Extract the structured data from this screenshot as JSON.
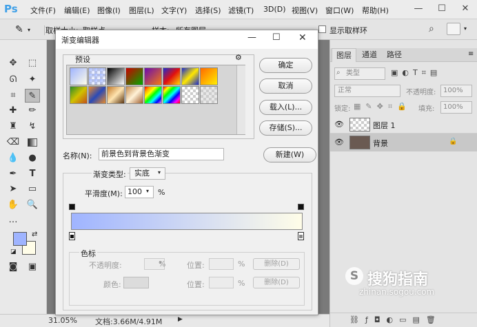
{
  "app": {
    "logo": "Ps"
  },
  "menu": [
    "文件(F)",
    "编辑(E)",
    "图像(I)",
    "图层(L)",
    "文字(Y)",
    "选择(S)",
    "滤镜(T)",
    "3D(D)",
    "视图(V)",
    "窗口(W)",
    "帮助(H)"
  ],
  "window_controls": {
    "minimize": "—",
    "maximize": "☐",
    "close": "✕"
  },
  "options_bar": {
    "sample_size_label": "取样大小:",
    "sample_size_value": "取样点",
    "sample_label": "样本:",
    "sample_value": "所有图层",
    "show_ring_label": "显示取样环"
  },
  "dialog": {
    "title": "渐变编辑器",
    "presets_label": "预设",
    "gear": "⚙",
    "buttons": {
      "ok": "确定",
      "cancel": "取消",
      "load": "载入(L)...",
      "save": "存储(S)...",
      "new": "新建(W)"
    },
    "name_label": "名称(N):",
    "name_value": "前景色到背景色渐变",
    "gradient_type_label": "渐变类型:",
    "gradient_type_value": "实底",
    "smoothness_label": "平滑度(M):",
    "smoothness_value": "100",
    "smoothness_unit": "%",
    "stops_section": "色标",
    "opacity_label": "不透明度:",
    "opacity_unit": "%",
    "position_label_1": "位置:",
    "position_unit_1": "%",
    "delete_label_1": "删除(D)",
    "color_label": "颜色:",
    "position_label_2": "位置:",
    "position_unit_2": "%",
    "delete_label_2": "删除(D)",
    "gradient_colors": {
      "start": "#9fb4ff",
      "end": "#fffde8"
    }
  },
  "layers_panel": {
    "tabs": [
      "图层",
      "通道",
      "路径"
    ],
    "kind_label": "类型",
    "blend_mode": "正常",
    "opacity_label": "不透明度:",
    "opacity_value": "100%",
    "lock_label": "锁定:",
    "fill_label": "填充:",
    "fill_value": "100%",
    "layers": [
      {
        "name": "图层 1",
        "selected": false
      },
      {
        "name": "背景",
        "selected": true
      }
    ]
  },
  "colors": {
    "foreground": "#9fb4ff",
    "background": "#fffde8"
  },
  "status": {
    "zoom": "31.05%",
    "doc": "文档:3.66M/4.91M"
  },
  "watermark": {
    "brand": "搜狗指南",
    "url": "zhinan.sogou.com"
  }
}
